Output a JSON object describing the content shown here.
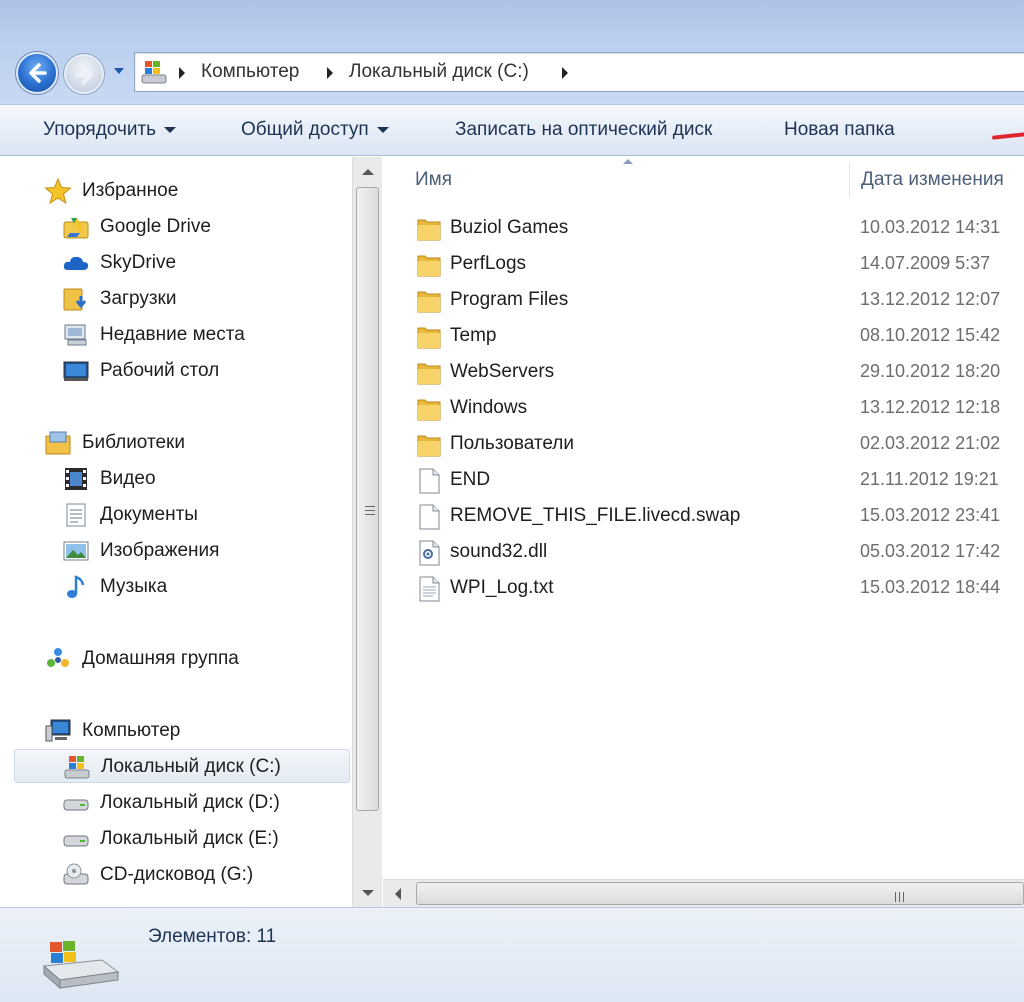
{
  "address_bar": {
    "crumbs": [
      "Компьютер",
      "Локальный диск (C:)"
    ]
  },
  "toolbar": {
    "organize": "Упорядочить",
    "share": "Общий доступ",
    "burn": "Записать на оптический диск",
    "new_folder": "Новая папка"
  },
  "sidebar": {
    "favorites": {
      "title": "Избранное",
      "items": [
        "Google Drive",
        "SkyDrive",
        "Загрузки",
        "Недавние места",
        "Рабочий стол"
      ]
    },
    "libraries": {
      "title": "Библиотеки",
      "items": [
        "Видео",
        "Документы",
        "Изображения",
        "Музыка"
      ]
    },
    "homegroup": {
      "title": "Домашняя группа"
    },
    "computer": {
      "title": "Компьютер",
      "items": [
        "Локальный диск (C:)",
        "Локальный диск (D:)",
        "Локальный диск (E:)",
        "CD-дисковод (G:)"
      ],
      "selected_index": 0
    }
  },
  "file_list": {
    "columns": {
      "name": "Имя",
      "date": "Дата изменения"
    },
    "rows": [
      {
        "name": "Buziol Games",
        "date": "10.03.2012 14:31",
        "icon": "folder-icon"
      },
      {
        "name": "PerfLogs",
        "date": "14.07.2009 5:37",
        "icon": "folder-icon"
      },
      {
        "name": "Program Files",
        "date": "13.12.2012 12:07",
        "icon": "folder-icon"
      },
      {
        "name": "Temp",
        "date": "08.10.2012 15:42",
        "icon": "folder-icon"
      },
      {
        "name": "WebServers",
        "date": "29.10.2012 18:20",
        "icon": "folder-icon"
      },
      {
        "name": "Windows",
        "date": "13.12.2012 12:18",
        "icon": "folder-icon"
      },
      {
        "name": "Пользователи",
        "date": "02.03.2012 21:02",
        "icon": "folder-icon"
      },
      {
        "name": "END",
        "date": "21.11.2012 19:21",
        "icon": "file-icon"
      },
      {
        "name": "REMOVE_THIS_FILE.livecd.swap",
        "date": "15.03.2012 23:41",
        "icon": "file-icon"
      },
      {
        "name": "sound32.dll",
        "date": "05.03.2012 17:42",
        "icon": "dll-icon"
      },
      {
        "name": "WPI_Log.txt",
        "date": "15.03.2012 18:44",
        "icon": "text-file-icon"
      }
    ]
  },
  "details_pane": {
    "item_count": "Элементов: 11"
  },
  "colors": {
    "title_bar": "#bcd0ef",
    "toolbar_text": "#1e3354",
    "folder": "#f0c348",
    "annotation_mark": "#e1252d"
  }
}
